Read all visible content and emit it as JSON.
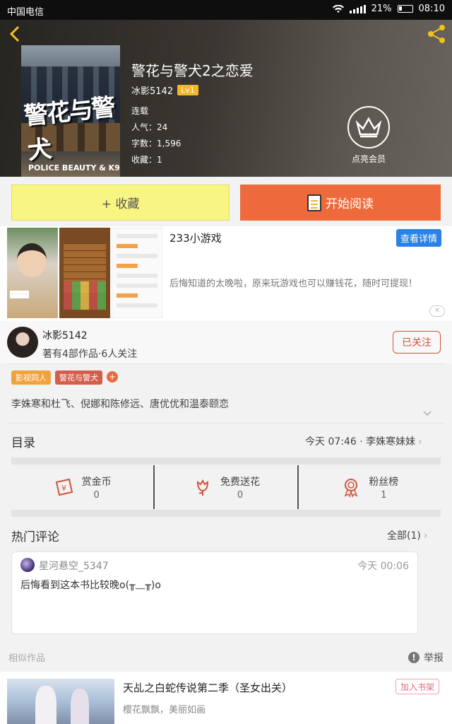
{
  "status_bar": {
    "carrier": "中国电信",
    "battery": "21%",
    "time": "08:10"
  },
  "book": {
    "title": "警花与警犬2之恋爱",
    "author": "冰影5142",
    "level": "Lv1",
    "status": "连载",
    "popularity": "人气：24",
    "word_count": "字数：1,596",
    "favorites": "收藏：1",
    "cover_title": "警花与警犬",
    "cover_subtitle": "POLICE BEAUTY & K9",
    "vip_label": "点亮会员"
  },
  "actions": {
    "collect": "+ 收藏",
    "read": "开始阅读"
  },
  "ad": {
    "title": "233小游戏",
    "detail": "查看详情",
    "description": "后悔知道的太晚啦，原来玩游戏也可以赚钱花，随时可提现！"
  },
  "author_card": {
    "name": "冰影5142",
    "info": "著有4部作品·6人关注",
    "follow": "已关注"
  },
  "tags": [
    "影视同人",
    "警花与警犬"
  ],
  "summary": "李姝寒和杜飞、倪娜和陈修远、唐优优和温泰颐恋",
  "catalog": {
    "label": "目录",
    "latest": "今天 07:46 · 李姝寒妹妹"
  },
  "stats": [
    {
      "label": "赏金币",
      "value": "0",
      "icon": "coin-icon"
    },
    {
      "label": "免费送花",
      "value": "0",
      "icon": "flower-icon"
    },
    {
      "label": "粉丝榜",
      "value": "1",
      "icon": "medal-icon"
    }
  ],
  "comments": {
    "title": "热门评论",
    "all": "全部(1)",
    "items": [
      {
        "user": "星河悬空_5347",
        "time": "今天 00:06",
        "text": "后悔看到这本书比较晚o(╥﹏╥)o"
      }
    ]
  },
  "similar": {
    "title": "相似作品",
    "report": "举报",
    "items": [
      {
        "title": "天乩之白蛇传说第二季（圣女出关）",
        "desc": "樱花飘飘，美丽如画",
        "add": "加入书架"
      }
    ]
  },
  "colors": {
    "accent": "#ee6a3c",
    "collect_bg": "#f9f582",
    "level": "#f3b52c",
    "ad_button": "#2a82e4"
  }
}
